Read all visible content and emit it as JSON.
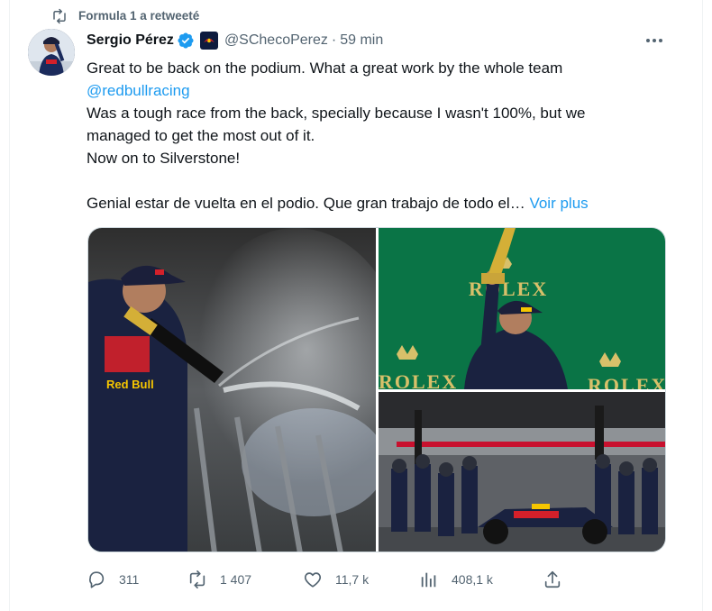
{
  "retweet": {
    "text": "Formula 1 a retweeté",
    "icon": "retweet-icon"
  },
  "author": {
    "name": "Sergio Pérez",
    "handle": "@SChecoPerez",
    "separator": "·",
    "time": "59 min",
    "verified_icon": "verified-badge-icon",
    "affiliate_icon": "red-bull-racing-badge-icon"
  },
  "tweet": {
    "line1": "Great to be back on the podium. What a great work by the whole team",
    "mention": "@redbullracing",
    "line3": "Was a tough race from the back, specially because I wasn't 100%, but we",
    "line4": "managed to get the most out of it.",
    "line5": "Now on to Silverstone!",
    "line6": "Genial estar de vuelta en el podio. Que gran trabajo de todo el…",
    "see_more": "Voir plus"
  },
  "media": {
    "photo1_text": [
      "Red Bull"
    ],
    "photo2_text": [
      "ROLEX",
      "ROLEX",
      "ROLEX"
    ]
  },
  "actions": {
    "reply_count": "311",
    "retweet_count": "1 407",
    "like_count": "11,7 k",
    "views_count": "408,1 k"
  },
  "colors": {
    "text": "#0f1419",
    "secondary": "#536471",
    "link": "#1d9bf0",
    "rolex_green": "#0c7a4a"
  }
}
